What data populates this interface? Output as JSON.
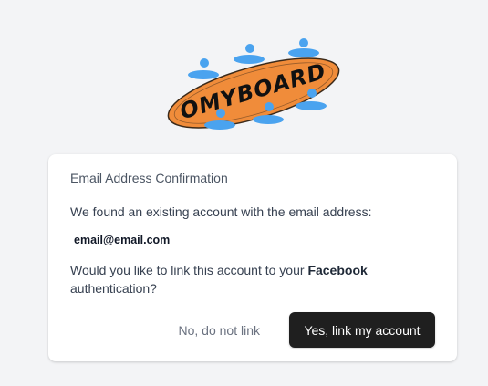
{
  "logo": {
    "text": "OMYBOARD",
    "icon": "omyboard-logo",
    "colors": {
      "board": "#f08c3a",
      "people": "#4aa3ef",
      "text": "#111111"
    }
  },
  "dialog": {
    "title": "Email Address Confirmation",
    "intro": "We found an existing account with the email address:",
    "email": "email@email.com",
    "question_prefix": "Would you like to link this account to your ",
    "provider": "Facebook",
    "question_suffix": " authentication?",
    "decline_label": "No, do not link",
    "accept_label": "Yes, link my account"
  },
  "colors": {
    "page_background": "#f3f4f6",
    "accept_button": "#1f1f1f"
  }
}
